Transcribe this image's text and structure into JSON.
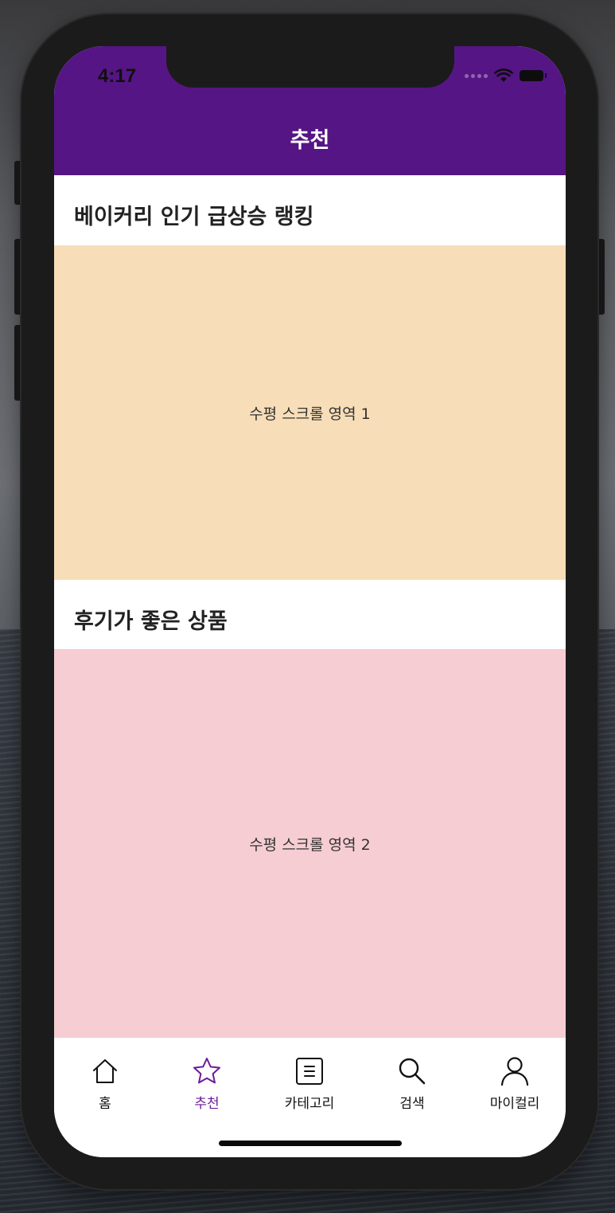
{
  "status_bar": {
    "time": "4:17",
    "wifi_icon": "wifi-icon",
    "battery_icon": "battery-icon"
  },
  "nav": {
    "title": "추천"
  },
  "sections": [
    {
      "title": "베이커리 인기 급상승 랭킹",
      "content": "수평 스크롤 영역 1",
      "color": "#F7DEB8"
    },
    {
      "title": "후기가 좋은 상품",
      "content": "수평 스크롤 영역 2",
      "color": "#F6CDD3"
    }
  ],
  "tabbar": {
    "items": [
      {
        "label": "홈",
        "icon": "home-icon"
      },
      {
        "label": "추천",
        "icon": "star-icon",
        "active": true
      },
      {
        "label": "카테고리",
        "icon": "list-icon"
      },
      {
        "label": "검색",
        "icon": "search-icon"
      },
      {
        "label": "마이컬리",
        "icon": "person-icon"
      }
    ]
  },
  "colors": {
    "accent": "#561584",
    "active_tab": "#6A1B9A"
  }
}
